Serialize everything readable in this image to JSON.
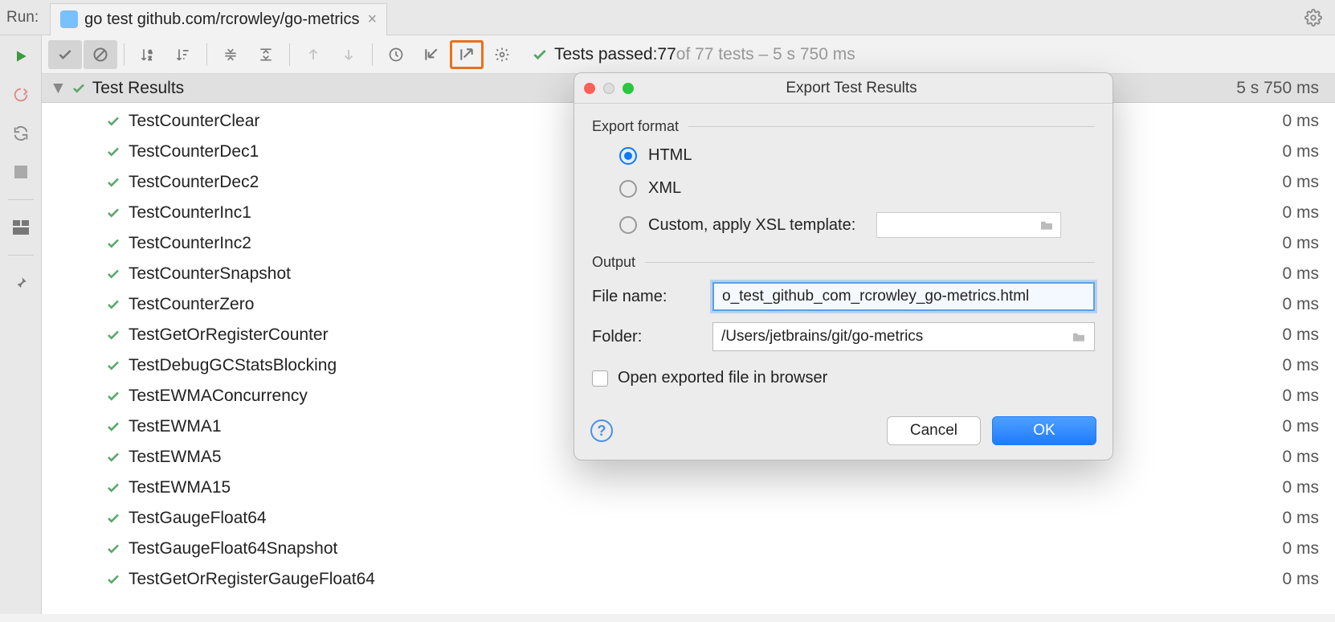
{
  "header": {
    "run_label": "Run:",
    "tab_title": "go test github.com/rcrowley/go-metrics"
  },
  "status": {
    "prefix": "Tests passed: ",
    "count": "77",
    "of_text": " of 77 tests – 5 s 750 ms"
  },
  "tree": {
    "root_label": "Test Results",
    "root_time": "5 s 750 ms",
    "tests": [
      {
        "name": "TestCounterClear",
        "time": "0 ms"
      },
      {
        "name": "TestCounterDec1",
        "time": "0 ms"
      },
      {
        "name": "TestCounterDec2",
        "time": "0 ms"
      },
      {
        "name": "TestCounterInc1",
        "time": "0 ms"
      },
      {
        "name": "TestCounterInc2",
        "time": "0 ms"
      },
      {
        "name": "TestCounterSnapshot",
        "time": "0 ms"
      },
      {
        "name": "TestCounterZero",
        "time": "0 ms"
      },
      {
        "name": "TestGetOrRegisterCounter",
        "time": "0 ms"
      },
      {
        "name": "TestDebugGCStatsBlocking",
        "time": "0 ms"
      },
      {
        "name": "TestEWMAConcurrency",
        "time": "0 ms"
      },
      {
        "name": "TestEWMA1",
        "time": "0 ms"
      },
      {
        "name": "TestEWMA5",
        "time": "0 ms"
      },
      {
        "name": "TestEWMA15",
        "time": "0 ms"
      },
      {
        "name": "TestGaugeFloat64",
        "time": "0 ms"
      },
      {
        "name": "TestGaugeFloat64Snapshot",
        "time": "0 ms"
      },
      {
        "name": "TestGetOrRegisterGaugeFloat64",
        "time": "0 ms"
      }
    ]
  },
  "dialog": {
    "title": "Export Test Results",
    "section_format": "Export format",
    "radio_html": "HTML",
    "radio_xml": "XML",
    "radio_custom": "Custom, apply XSL template:",
    "section_output": "Output",
    "file_label": "File name:",
    "file_value": "o_test_github_com_rcrowley_go-metrics.html",
    "folder_label": "Folder:",
    "folder_value": "/Users/jetbrains/git/go-metrics",
    "open_browser": "Open exported file in browser",
    "cancel": "Cancel",
    "ok": "OK"
  }
}
